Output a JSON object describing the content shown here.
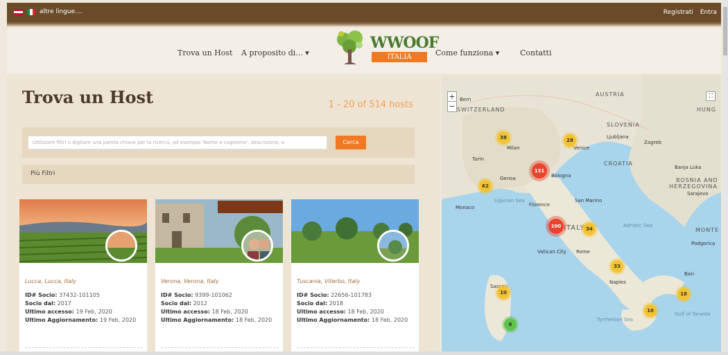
{
  "topbar": {
    "language_label": "altre lingue....",
    "register": "Registrati",
    "login": "Entra"
  },
  "nav": {
    "find_host": "Trova un Host",
    "about": "A proposito di... ▾",
    "how_it_works": "Come funziona ▾",
    "contacts": "Contatti",
    "logo_text": "WWOOF",
    "logo_sub": "ITALIA"
  },
  "main": {
    "title": "Trova un Host",
    "hits": "1 - 20 of 514 hosts",
    "search_placeholder": "Utilizzare filtri o digitare una parola chiave per la ricerca, ad esempio 'Nome e cognome', descrizione, e",
    "search_button": "Cerca",
    "more_filters": "Più Filtri"
  },
  "cards": [
    {
      "location": "Lucca, Lucca, Italy",
      "id_label": "ID# Socio:",
      "id": "37432-101105",
      "since_label": "Socio dal:",
      "since": "2017",
      "access_label": "Ultimo accesso:",
      "access": "19 Feb, 2020",
      "update_label": "Ultimo Aggiornamento:",
      "update": "19 Feb, 2020"
    },
    {
      "location": "Verona, Verona, Italy",
      "id_label": "ID# Socio:",
      "id": "9399-101062",
      "since_label": "Socio dal:",
      "since": "2012",
      "access_label": "Ultimo accesso:",
      "access": "18 Feb, 2020",
      "update_label": "Ultimo Aggiornamento:",
      "update": "18 Feb, 2020"
    },
    {
      "location": "Tuscania, Viterbo, Italy",
      "id_label": "ID# Socio:",
      "id": "22656-101783",
      "since_label": "Socio dal:",
      "since": "2018",
      "access_label": "Ultimo accesso:",
      "access": "18 Feb, 2020",
      "update_label": "Ultimo Aggiornamento:",
      "update": "18 Feb, 2020"
    }
  ],
  "map": {
    "zoom_in": "+",
    "zoom_out": "−",
    "clusters": [
      "38",
      "28",
      "131",
      "62",
      "100",
      "34",
      "33",
      "10",
      "18",
      "10",
      "6"
    ],
    "labels": {
      "bern": "Bern",
      "switzerland": "SWITZERLAND",
      "austria": "AUSTRIA",
      "hungary": "HUNG",
      "slovenia": "SLOVENIA",
      "ljubljana": "Ljubljana",
      "zagreb": "Zagreb",
      "croatia": "CROATIA",
      "banja_luka": "Banja Luka",
      "bosnia": "BOSNIA AND",
      "herzegovina": "HERZEGOVINA",
      "sarajevo": "Sarajevo",
      "milan": "Milan",
      "venice": "Venice",
      "turin": "Turin",
      "genoa": "Genoa",
      "bologna": "Bologna",
      "monaco": "Monaco",
      "ligurian_sea": "Ligurian Sea",
      "florence": "Florence",
      "san_marino": "San Marino",
      "italy": "ITALY",
      "adriatic": "Adriatic Sea",
      "monte": "MONTE",
      "podgorica": "Podgorica",
      "vatican": "Vatican City",
      "rome": "Rome",
      "naples": "Naples",
      "bari": "Bari",
      "sassari": "Sassari",
      "tyrrhenian": "Tyrrhenian Sea",
      "taranto": "Gulf of Taranto"
    }
  },
  "colors": {
    "brown": "#6b4a2a",
    "orange": "#f07a24",
    "green": "#4a7a2f",
    "cluster_yellow": "#f2c230",
    "cluster_red": "#e8432d",
    "cluster_green": "#5fc24a"
  }
}
